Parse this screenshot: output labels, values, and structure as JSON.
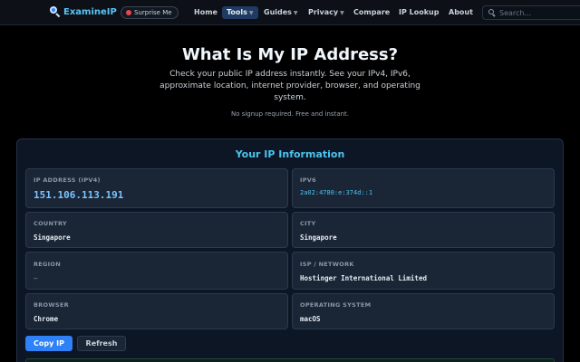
{
  "nav": {
    "brand": "ExamineIP",
    "surprise": "Surprise Me",
    "items": [
      {
        "label": "Home"
      },
      {
        "label": "Tools"
      },
      {
        "label": "Guides"
      },
      {
        "label": "Privacy"
      },
      {
        "label": "Compare"
      },
      {
        "label": "IP Lookup"
      },
      {
        "label": "About"
      }
    ],
    "search_placeholder": "Search..."
  },
  "hero": {
    "title": "What Is My IP Address?",
    "description": "Check your public IP address instantly. See your IPv4, IPv6, approximate location, internet provider, browser, and operating system.",
    "note": "No signup required. Free and instant."
  },
  "panel": {
    "title": "Your IP Information",
    "cards": [
      {
        "label": "IP ADDRESS (IPV4)",
        "value": "151.106.113.191"
      },
      {
        "label": "IPV6",
        "value": "2a02:4780:e:374d::1"
      },
      {
        "label": "COUNTRY",
        "value": "Singapore"
      },
      {
        "label": "CITY",
        "value": "Singapore"
      },
      {
        "label": "REGION",
        "value": "—"
      },
      {
        "label": "ISP / NETWORK",
        "value": "Hostinger International Limited"
      },
      {
        "label": "BROWSER",
        "value": "Chrome"
      },
      {
        "label": "OPERATING SYSTEM",
        "value": "macOS"
      }
    ],
    "copy_button": "Copy IP",
    "refresh_button": "Refresh"
  },
  "colors": {
    "accent": "#2f81f7",
    "title_cyan": "#4cc3f0",
    "background": "#000000",
    "card": "#1a2535"
  }
}
